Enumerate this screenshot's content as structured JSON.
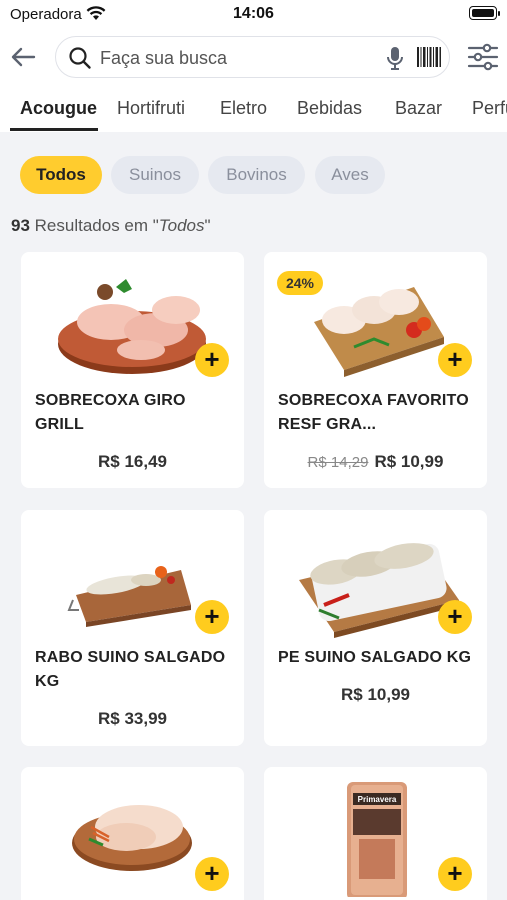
{
  "status": {
    "carrier": "Operadora",
    "time": "14:06"
  },
  "search": {
    "placeholder": "Faça sua busca"
  },
  "tabs": [
    "Acougue",
    "Hortifruti",
    "Eletro",
    "Bebidas",
    "Bazar",
    "Perfu"
  ],
  "chips": [
    "Todos",
    "Suinos",
    "Bovinos",
    "Aves"
  ],
  "results": {
    "count": "93",
    "text": " Resultados em \"",
    "filter": "Todos",
    "end": "\""
  },
  "products": [
    {
      "name": "SOBRECOXA GIRO GRILL",
      "price": "R$ 16,49",
      "old_price": "",
      "badge": ""
    },
    {
      "name": "SOBRECOXA FAVORITO RESF GRA...",
      "price": "R$ 10,99",
      "old_price": "R$ 14,29",
      "badge": "24%"
    },
    {
      "name": "RABO SUINO SALGADO KG",
      "price": "R$ 33,99",
      "old_price": "",
      "badge": ""
    },
    {
      "name": "PE SUINO SALGADO KG",
      "price": "R$ 10,99",
      "old_price": "",
      "badge": ""
    },
    {
      "name": "",
      "price": "",
      "old_price": "",
      "badge": ""
    },
    {
      "name": "",
      "price": "",
      "old_price": "",
      "badge": "",
      "package_label": "Primavera"
    }
  ],
  "colors": {
    "accent": "#ffcc1e",
    "chip_bg": "#e6e9f0",
    "background": "#f2f3f6"
  }
}
